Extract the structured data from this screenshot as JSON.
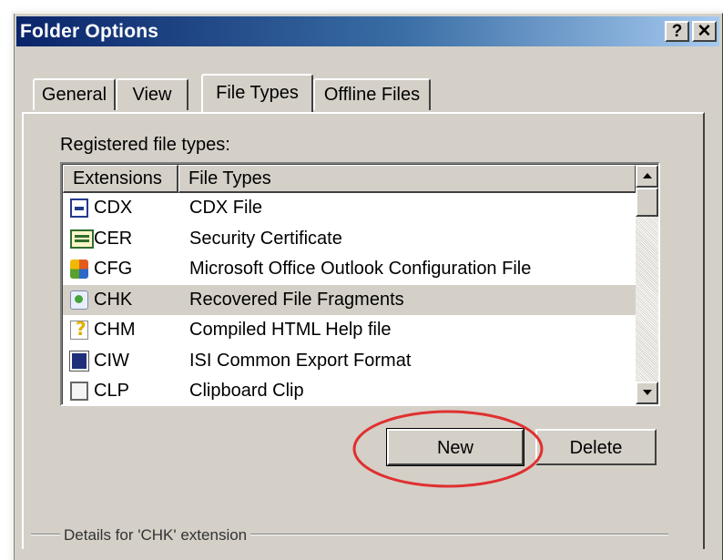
{
  "window": {
    "title": "Folder Options",
    "help_button": "?",
    "close_button": "✕"
  },
  "tabs": [
    {
      "label": "General"
    },
    {
      "label": "View"
    },
    {
      "label": "File Types",
      "active": true
    },
    {
      "label": "Offline Files"
    }
  ],
  "file_types": {
    "label": "Registered file types:",
    "columns": [
      "Extensions",
      "File Types"
    ],
    "rows": [
      {
        "ext": "CDX",
        "type": "CDX File",
        "icon": "cdx-file-icon"
      },
      {
        "ext": "CER",
        "type": "Security Certificate",
        "icon": "certificate-icon"
      },
      {
        "ext": "CFG",
        "type": "Microsoft Office Outlook Configuration File",
        "icon": "office-config-icon"
      },
      {
        "ext": "CHK",
        "type": "Recovered File Fragments",
        "icon": "recovered-fragments-icon",
        "selected": true
      },
      {
        "ext": "CHM",
        "type": "Compiled HTML Help file",
        "icon": "help-file-icon"
      },
      {
        "ext": "CIW",
        "type": "ISI Common Export Format",
        "icon": "isi-export-icon"
      },
      {
        "ext": "CLP",
        "type": "Clipboard Clip",
        "icon": "clipboard-icon"
      }
    ]
  },
  "buttons": {
    "new_label": "New",
    "delete_label": "Delete"
  },
  "details": {
    "group_label": "Details for 'CHK' extension"
  },
  "annotation": {
    "highlight_color": "#e03030"
  }
}
